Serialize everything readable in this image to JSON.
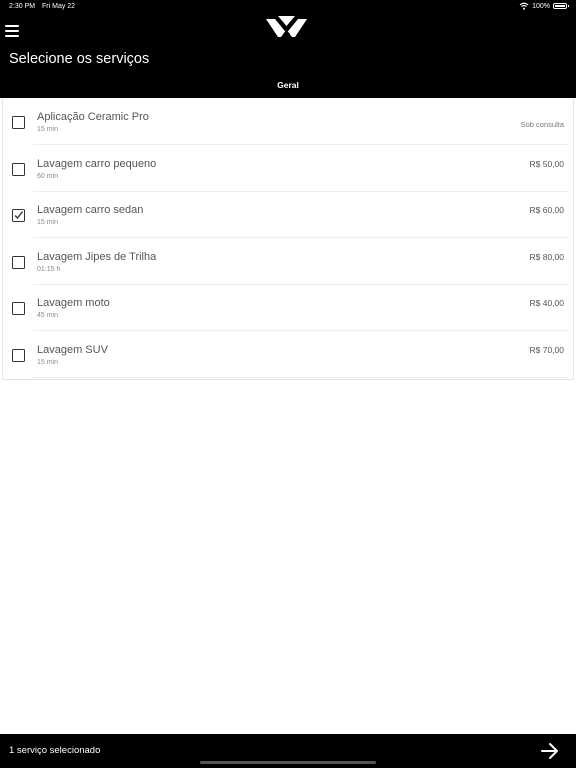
{
  "status_bar": {
    "time": "2:30 PM",
    "date": "Fri May 22",
    "battery": "100%",
    "battery_level": 1.0,
    "wifi_icon": "wifi-icon"
  },
  "header": {
    "menu_icon": "hamburger-menu-icon",
    "logo_icon": "brand-logo-icon",
    "title": "Selecione os serviços",
    "tab": "Geral"
  },
  "services": [
    {
      "name": "Aplicação Ceramic Pro",
      "duration": "15 min",
      "price": "Sob consulta",
      "checked": false
    },
    {
      "name": "Lavagem carro pequeno",
      "duration": "60 min",
      "price": "R$ 50,00",
      "checked": false
    },
    {
      "name": "Lavagem carro sedan",
      "duration": "15 min",
      "price": "R$ 60,00",
      "checked": true
    },
    {
      "name": "Lavagem Jipes de Trilha",
      "duration": "01:15 h",
      "price": "R$ 80,00",
      "checked": false
    },
    {
      "name": "Lavagem moto",
      "duration": "45 min",
      "price": "R$ 40,00",
      "checked": false
    },
    {
      "name": "Lavagem SUV",
      "duration": "15 min",
      "price": "R$ 70,00",
      "checked": false
    }
  ],
  "footer": {
    "selected_text": "1 serviço selecionado",
    "next_icon": "arrow-right-icon"
  },
  "colors": {
    "header_bg": "#000000",
    "text_primary": "#555555",
    "text_secondary": "#8a8a8a"
  }
}
